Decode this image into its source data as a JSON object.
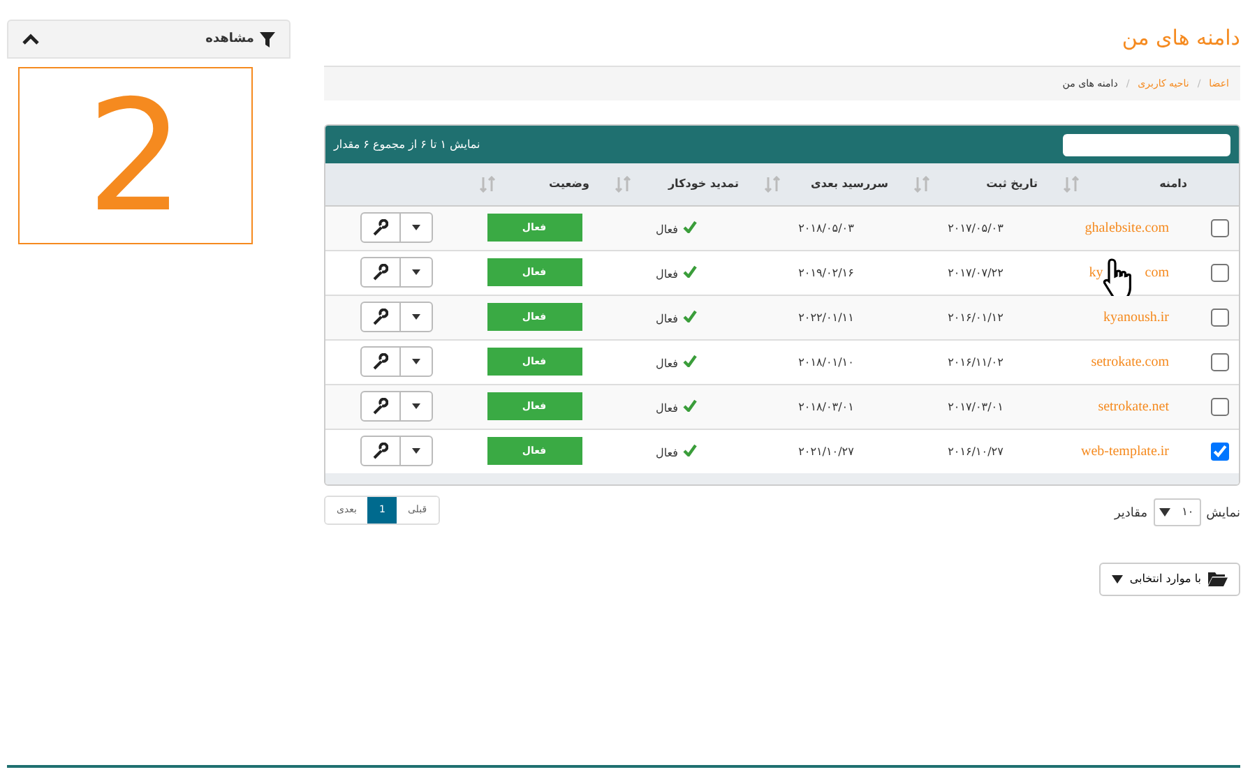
{
  "sidebar": {
    "title": "مشاهده",
    "expanded": true,
    "counter": "2"
  },
  "page_title": "دامنه های من",
  "breadcrumb_separator": "/",
  "breadcrumb": [
    {
      "label": "اعضا",
      "link": true
    },
    {
      "label": "ناحیه کاربری",
      "link": true
    },
    {
      "label": "دامنه های من",
      "link": false
    }
  ],
  "table": {
    "info": "نمایش ۱ تا ۶ از مجموع ۶ مقدار",
    "columns": [
      "دامنه",
      "تاریخ ثبت",
      "سررسید بعدی",
      "تمدید خودکار",
      "وضعیت"
    ],
    "rows": [
      {
        "checked": false,
        "domain": "ghalebsite.com",
        "registered": "۲۰۱۷/۰۵/۰۳",
        "next_due": "۲۰۱۸/۰۵/۰۳",
        "auto_renew": "فعال",
        "status": "فعال"
      },
      {
        "checked": false,
        "domain": "ky",
        "domain_tail": "com",
        "cursor": true,
        "registered": "۲۰۱۷/۰۷/۲۲",
        "next_due": "۲۰۱۹/۰۲/۱۶",
        "auto_renew": "فعال",
        "status": "فعال"
      },
      {
        "checked": false,
        "domain": "kyanoush.ir",
        "registered": "۲۰۱۶/۰۱/۱۲",
        "next_due": "۲۰۲۲/۰۱/۱۱",
        "auto_renew": "فعال",
        "status": "فعال"
      },
      {
        "checked": false,
        "domain": "setrokate.com",
        "registered": "۲۰۱۶/۱۱/۰۲",
        "next_due": "۲۰۱۸/۰۱/۱۰",
        "auto_renew": "فعال",
        "status": "فعال"
      },
      {
        "checked": false,
        "domain": "setrokate.net",
        "registered": "۲۰۱۷/۰۳/۰۱",
        "next_due": "۲۰۱۸/۰۳/۰۱",
        "auto_renew": "فعال",
        "status": "فعال"
      },
      {
        "checked": true,
        "domain": "web-template.ir",
        "registered": "۲۰۱۶/۱۰/۲۷",
        "next_due": "۲۰۲۱/۱۰/۲۷",
        "auto_renew": "فعال",
        "status": "فعال"
      }
    ]
  },
  "page_size": {
    "prefix": "نمایش",
    "value": "۱۰",
    "suffix": "مقادیر"
  },
  "pagination": [
    {
      "label": "قبلی",
      "selected": false
    },
    {
      "label": "1",
      "selected": true
    },
    {
      "label": "بعدی",
      "selected": false
    }
  ],
  "bulk_button": "با موارد انتخابی"
}
